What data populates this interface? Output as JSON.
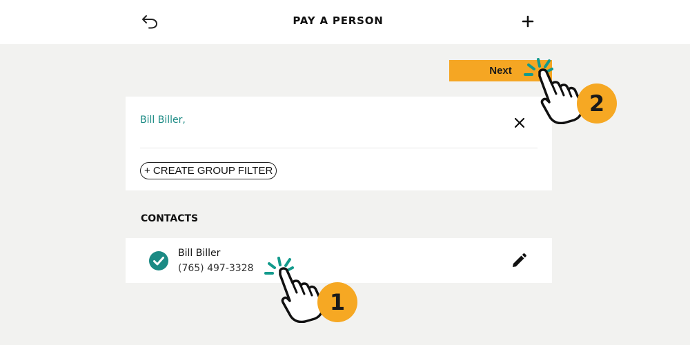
{
  "header": {
    "title": "PAY A PERSON",
    "back_icon": "undo-arrow-icon",
    "add_icon": "plus-icon"
  },
  "next_button": {
    "label": "Next"
  },
  "recipient_card": {
    "selected_text": "Bill Biller,",
    "clear_icon": "close-icon",
    "group_filter_label": "+ CREATE GROUP FILTER"
  },
  "contacts": {
    "heading": "CONTACTS",
    "items": [
      {
        "name": "Bill Biller",
        "phone": "(765) 497-3328",
        "selected": true,
        "status_icon": "checkmark-circle-icon",
        "action_icon": "pencil-icon"
      }
    ]
  },
  "annotations": [
    {
      "step": "1",
      "icon": "pointing-hand-icon"
    },
    {
      "step": "2",
      "icon": "pointing-hand-icon"
    }
  ],
  "colors": {
    "accent_orange": "#f5a623",
    "teal": "#1b8a84",
    "background": "#f2f2f0",
    "card": "#ffffff"
  }
}
